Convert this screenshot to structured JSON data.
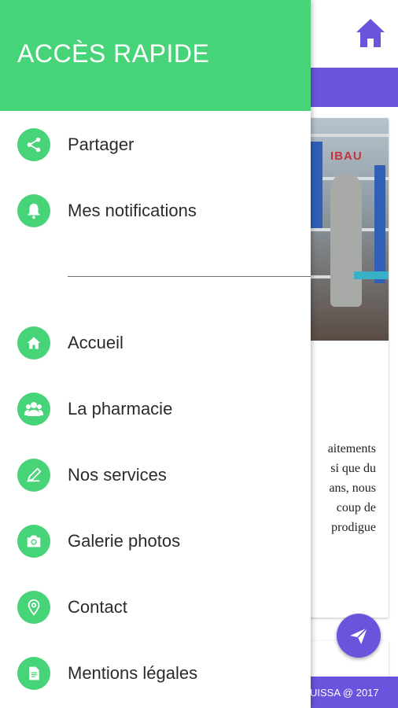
{
  "drawer": {
    "title": "ACCÈS RAPIDE",
    "items": [
      {
        "label": "Partager",
        "icon": "share-icon"
      },
      {
        "label": "Mes notifications",
        "icon": "bell-icon"
      },
      {
        "label": "Accueil",
        "icon": "home-icon"
      },
      {
        "label": "La pharmacie",
        "icon": "people-icon"
      },
      {
        "label": "Nos services",
        "icon": "pen-icon"
      },
      {
        "label": "Galerie photos",
        "icon": "camera-icon"
      },
      {
        "label": "Contact",
        "icon": "location-pin-icon"
      },
      {
        "label": "Mentions légales",
        "icon": "document-icon"
      }
    ]
  },
  "background": {
    "photo_sign": "IBAU",
    "text_lines": [
      "aitements",
      "si que du",
      "ans, nous",
      "coup de",
      "prodigue"
    ],
    "footer": "UISSA @ 2017"
  },
  "colors": {
    "accent_green": "#47d479",
    "accent_purple": "#6a54de"
  }
}
